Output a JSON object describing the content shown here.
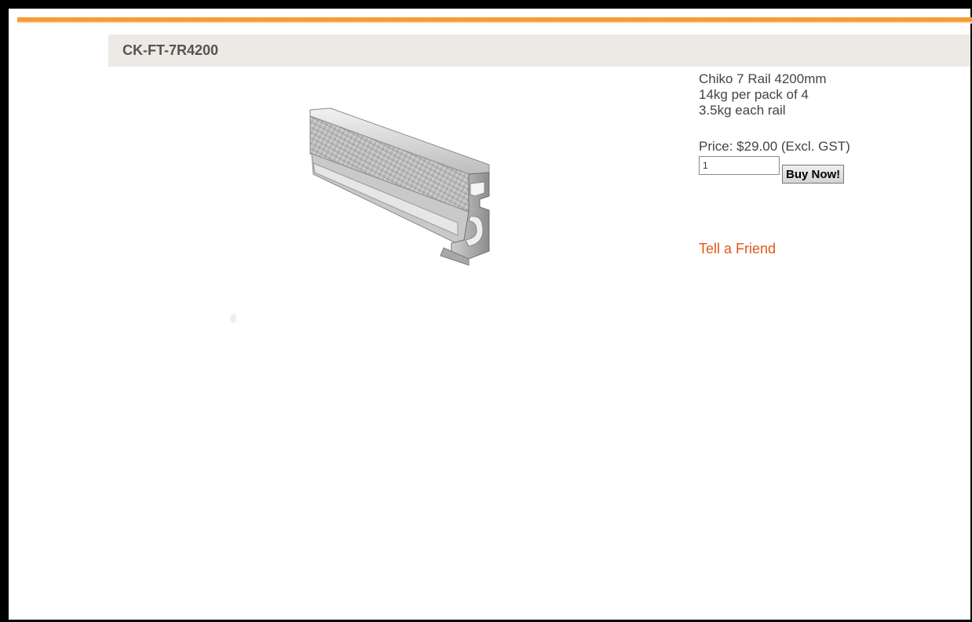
{
  "product": {
    "sku": "CK-FT-7R4200",
    "image_icon": "aluminium-rail-image",
    "description_lines": [
      "Chiko 7 Rail 4200mm",
      "14kg per pack of 4",
      "3.5kg each rail"
    ],
    "price_text": "Price: $29.00 (Excl. GST)",
    "quantity_value": "1",
    "buy_label": "Buy Now!",
    "tell_friend_label": "Tell a Friend"
  },
  "colors": {
    "accent": "#f39a30",
    "header_bg": "#ede9e4",
    "link": "#e2561b",
    "frame": "#000000"
  }
}
